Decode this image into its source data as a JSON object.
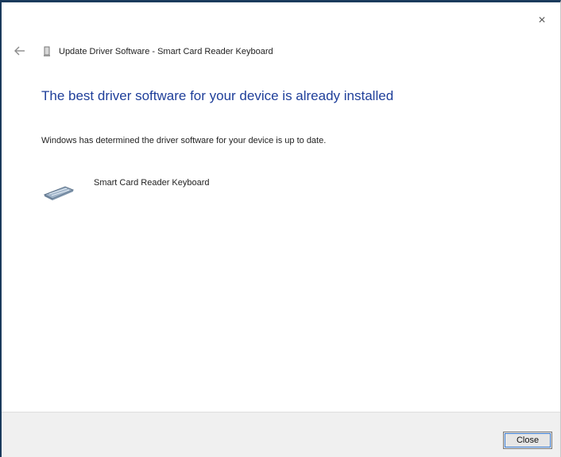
{
  "window": {
    "close_glyph": "×",
    "title": "Update Driver Software - Smart Card Reader Keyboard"
  },
  "content": {
    "heading": "The best driver software for your device is already installed",
    "description": "Windows has determined the driver software for your device is up to date.",
    "device_name": "Smart Card Reader Keyboard",
    "device_icon": "keyboard-device-icon"
  },
  "footer": {
    "close_label": "Close"
  },
  "colors": {
    "heading": "#1f3f9a",
    "footer_bg": "#f0f0f0",
    "window_border": "#1a3a5c"
  }
}
